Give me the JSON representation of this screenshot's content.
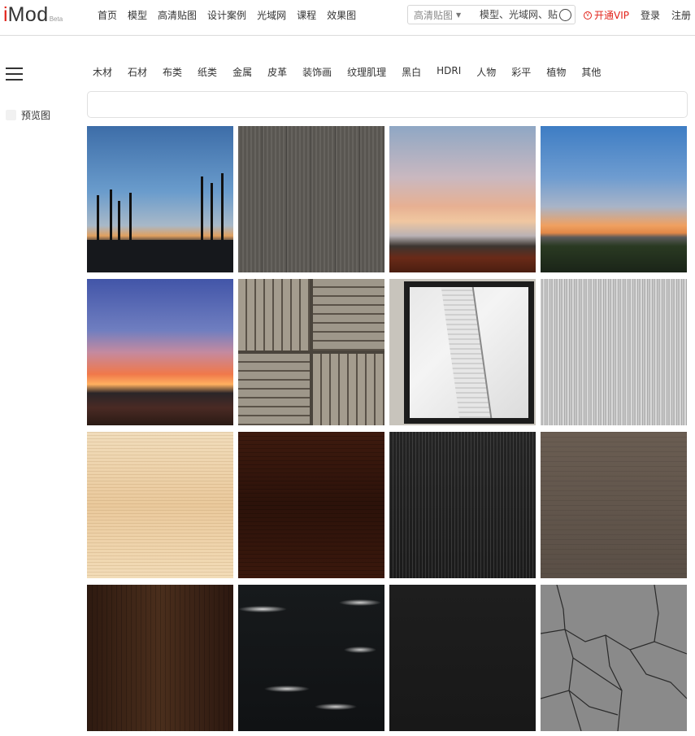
{
  "header": {
    "logo": {
      "i": "i",
      "mod": "Mod",
      "beta": "Beta"
    },
    "nav": [
      {
        "label": "首页"
      },
      {
        "label": "模型"
      },
      {
        "label": "高清贴图"
      },
      {
        "label": "设计案例"
      },
      {
        "label": "光域网"
      },
      {
        "label": "课程"
      },
      {
        "label": "效果图"
      }
    ],
    "search": {
      "selected_type": "高清贴图",
      "placeholder": "模型、光域网、贴图"
    },
    "vip_label": "开通VIP",
    "login_label": "登录",
    "register_label": "注册",
    "accent_color": "#e2231a"
  },
  "sidebar": {
    "preview_label": "预览图",
    "preview_checked": false
  },
  "categories": [
    {
      "label": "木材"
    },
    {
      "label": "石材"
    },
    {
      "label": "布类"
    },
    {
      "label": "纸类"
    },
    {
      "label": "金属"
    },
    {
      "label": "皮革"
    },
    {
      "label": "装饰画"
    },
    {
      "label": "纹理肌理"
    },
    {
      "label": "黑白"
    },
    {
      "label": "HDRI"
    },
    {
      "label": "人物"
    },
    {
      "label": "彩平"
    },
    {
      "label": "植物"
    },
    {
      "label": "其他"
    }
  ],
  "thumbnails": [
    {
      "name": "thumb-sunset-trees",
      "texture": "t-sky1"
    },
    {
      "name": "thumb-grey-wood-planks",
      "texture": "t-wood-grey"
    },
    {
      "name": "thumb-dusk-clouds-field",
      "texture": "t-sky2"
    },
    {
      "name": "thumb-sunset-clouds-field",
      "texture": "t-sky3"
    },
    {
      "name": "thumb-purple-sunset",
      "texture": "t-sky4"
    },
    {
      "name": "thumb-wood-parquet",
      "texture": "t-parquet"
    },
    {
      "name": "thumb-framed-map",
      "texture": "t-map"
    },
    {
      "name": "thumb-white-wood-grain",
      "texture": "t-wood-white"
    },
    {
      "name": "thumb-birch-wood",
      "texture": "t-birch"
    },
    {
      "name": "thumb-walnut-wood",
      "texture": "t-walnut"
    },
    {
      "name": "thumb-dark-wood-grain",
      "texture": "t-dark-wood"
    },
    {
      "name": "thumb-taupe-wood",
      "texture": "t-taupe"
    },
    {
      "name": "thumb-dark-brown-wood",
      "texture": "t-dark-brown"
    },
    {
      "name": "thumb-black-marble",
      "texture": "t-marble"
    },
    {
      "name": "thumb-black-leather",
      "texture": "t-black"
    },
    {
      "name": "thumb-cracked-concrete",
      "texture": "t-cracked"
    }
  ]
}
